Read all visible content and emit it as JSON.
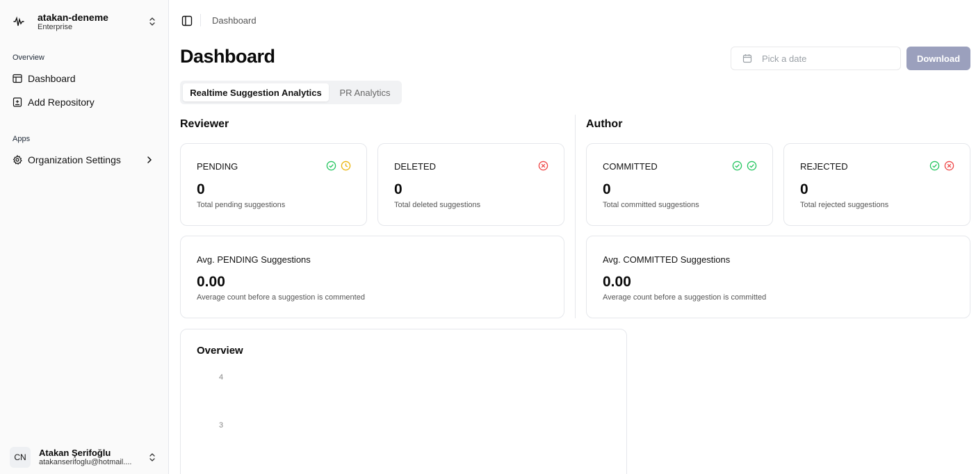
{
  "sidebar": {
    "org": {
      "name": "atakan-deneme",
      "plan": "Enterprise"
    },
    "sections": [
      {
        "label": "Overview",
        "items": [
          {
            "label": "Dashboard",
            "icon": "layout-icon"
          },
          {
            "label": "Add Repository",
            "icon": "repo-add-icon"
          }
        ]
      },
      {
        "label": "Apps",
        "items": [
          {
            "label": "Organization Settings",
            "icon": "gear-icon"
          }
        ]
      }
    ],
    "user": {
      "initials": "CN",
      "name": "Atakan Şerifoğlu",
      "email": "atakanserifoglu@hotmail...."
    }
  },
  "header": {
    "breadcrumb": "Dashboard"
  },
  "main": {
    "title": "Dashboard",
    "date_placeholder": "Pick a date",
    "download_label": "Download",
    "tabs": [
      {
        "label": "Realtime Suggestion Analytics",
        "active": true
      },
      {
        "label": "PR Analytics",
        "active": false
      }
    ],
    "reviewer": {
      "title": "Reviewer",
      "cards": [
        {
          "label": "PENDING",
          "value": "0",
          "desc": "Total pending suggestions"
        },
        {
          "label": "DELETED",
          "value": "0",
          "desc": "Total deleted suggestions"
        }
      ],
      "avg": {
        "label": "Avg. PENDING Suggestions",
        "value": "0.00",
        "desc": "Average count before a suggestion is commented"
      }
    },
    "author": {
      "title": "Author",
      "cards": [
        {
          "label": "COMMITTED",
          "value": "0",
          "desc": "Total committed suggestions"
        },
        {
          "label": "REJECTED",
          "value": "0",
          "desc": "Total rejected suggestions"
        }
      ],
      "avg": {
        "label": "Avg. COMMITTED Suggestions",
        "value": "0.00",
        "desc": "Average count before a suggestion is committed"
      }
    },
    "overview": {
      "title": "Overview",
      "yticks": [
        "4",
        "3"
      ]
    }
  },
  "colors": {
    "success": "#22c55e",
    "warning": "#eab308",
    "danger": "#ef4444",
    "primary_disabled": "#9ba0bd"
  }
}
